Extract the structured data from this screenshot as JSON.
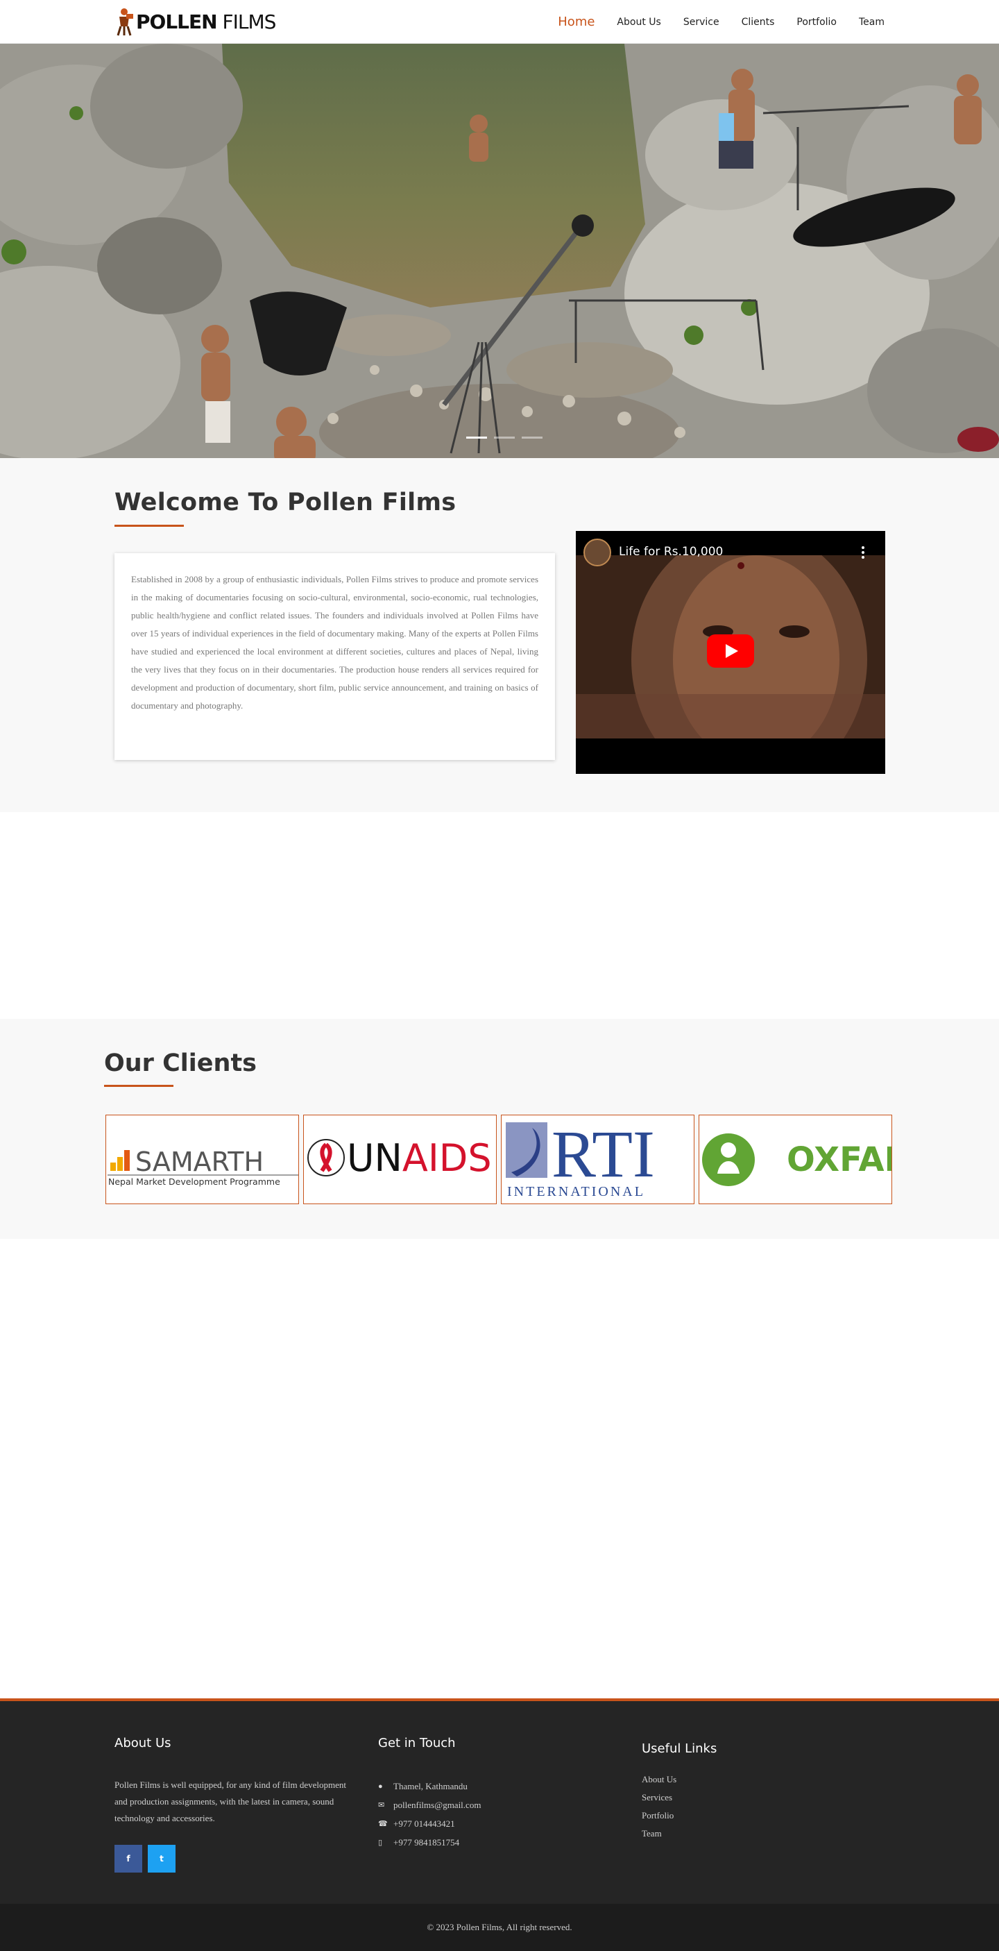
{
  "brand": {
    "bold": "POLLEN",
    "light": " FILMS"
  },
  "nav": {
    "items": [
      "Home",
      "About Us",
      "Service",
      "Clients",
      "Portfolio",
      "Team"
    ],
    "active": "Home"
  },
  "welcome": {
    "title": "Welcome To Pollen Films",
    "body": "Established in 2008 by a group of enthusiastic individuals, Pollen Films strives to produce and promote services in the making of documentaries focusing on socio-cultural, environmental, socio-economic, rual technologies, public health/hygiene and conflict related issues. The founders and individuals involved at Pollen Films have over 15 years of individual experiences in the field of documentary making. Many of the experts at Pollen Films have studied and experienced the local environment at different societies, cultures and places of Nepal, living the very lives that they focus on in their documentaries. The production house renders all services required for development and production of documentary, short film, public service announcement, and training on basics of documentary and photography."
  },
  "video": {
    "title": "Life for Rs.10,000"
  },
  "clients": {
    "title": "Our Clients",
    "logos": [
      {
        "name": "SAMARTH",
        "tagline": "Nepal Market Development Programme"
      },
      {
        "name_black": "UN",
        "name_red": "AIDS"
      },
      {
        "name": "RTI",
        "tagline": "INTERNATIONAL"
      },
      {
        "name": "OXFAM"
      }
    ]
  },
  "footer": {
    "about_title": "About Us",
    "about_text": "Pollen Films is well equipped, for any kind of film development and production assignments, with the latest in camera, sound technology and accessories.",
    "social": {
      "facebook": "f",
      "twitter": "t"
    },
    "contact_title": "Get in Touch",
    "contact": {
      "address": "Thamel, Kathmandu",
      "email": "pollenfilms@gmail.com",
      "phone": "+977 014443421",
      "mobile": "+977 9841851754"
    },
    "links_title": "Useful Links",
    "links": [
      "About Us",
      "Services",
      "Portfolio",
      "Team"
    ],
    "copyright": "© 2023 Pollen Films, All right reserved."
  },
  "colors": {
    "accent": "#c8541b",
    "footer_bg": "#252525",
    "section_bg": "#f8f8f8"
  },
  "hero": {
    "slides": 3,
    "active_slide": 1
  }
}
